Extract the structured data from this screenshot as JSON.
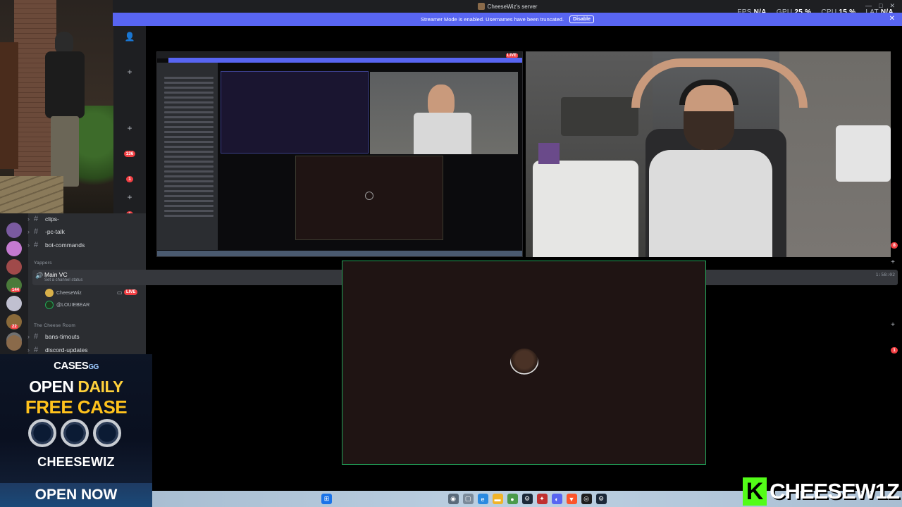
{
  "window": {
    "title": "CheeseWiz's server",
    "controls": [
      "—",
      "□",
      "✕"
    ]
  },
  "stats": [
    {
      "label": "FPS",
      "value": "N/A"
    },
    {
      "label": "GPU",
      "value": "25 %"
    },
    {
      "label": "CPU",
      "value": "15 %"
    },
    {
      "label": "LAT",
      "value": "N/A"
    }
  ],
  "banner": {
    "text": "Streamer Mode is enabled. Usernames have been truncated.",
    "button": "Disable"
  },
  "rail_badges": [
    "136",
    "1",
    "1"
  ],
  "guild_badges": [
    "144",
    "22"
  ],
  "channels": [
    {
      "name": "clips-",
      "prefix": "#"
    },
    {
      "name": "-pc-talk",
      "prefix": "#"
    },
    {
      "name": "bot-commands",
      "prefix": "#",
      "badge": "8"
    }
  ],
  "category_yappers": "Yappers",
  "voice": {
    "name": "Main VC",
    "status": "Set a channel status",
    "time": "1:58:02"
  },
  "members": [
    {
      "name": "CheeseWiz",
      "live": "LIVE"
    },
    {
      "name": "@LOUIEBEAR"
    }
  ],
  "category_cheese": "The Cheese Room",
  "channels2": [
    {
      "name": "bans-timouts",
      "prefix": "#"
    },
    {
      "name": "discord-updates",
      "prefix": "#",
      "badge": "1"
    }
  ],
  "ad": {
    "brand": "CASES",
    "brand_suffix": "GG",
    "line1a": "OPEN ",
    "line1b": "DAILY",
    "line2": "FREE CASE",
    "code": "CHEESEWIZ",
    "cta": "OPEN NOW"
  },
  "share_live": "LIVE",
  "watermark": {
    "k": "K",
    "text": "CHEESEW1Z"
  },
  "colors": {
    "blurple": "#5865f2",
    "live_red": "#f23f43",
    "speaking_green": "#23a55a",
    "kick_green": "#53fc18"
  }
}
